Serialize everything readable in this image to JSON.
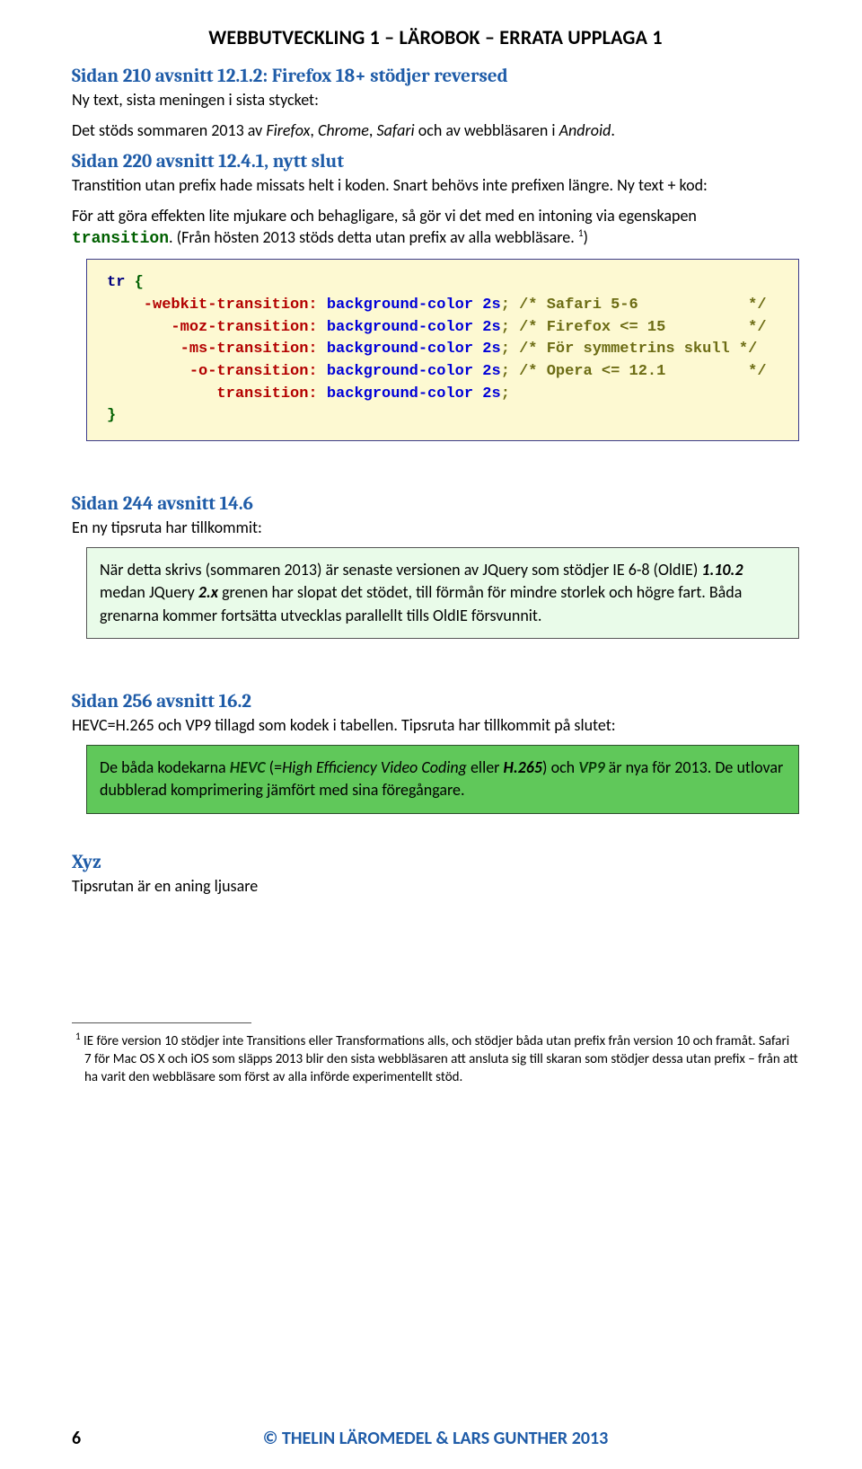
{
  "docTitle": "WEBBUTVECKLING 1 – LÄROBOK – ERRATA UPPLAGA 1",
  "sec1": {
    "heading": "Sidan 210 avsnitt 12.1.2: Firefox 18+ stödjer reversed",
    "line1": "Ny text, sista meningen i sista stycket:",
    "line2_lead": "Det stöds sommaren 2013 av ",
    "firefox": "Firefox",
    "chrome": "Chrome",
    "safari": "Safari",
    "mid": " och av webbläsaren i ",
    "android": "Android"
  },
  "sec2": {
    "heading": "Sidan 220 avsnitt 12.4.1, nytt slut",
    "line1": "Transtition utan prefix hade missats helt i koden. Snart behövs inte prefixen längre. Ny text + kod:",
    "line2a": "För att göra effekten lite mjukare och behagligare, så gör vi det med en intoning via egenskapen ",
    "transitionWord": "transition",
    "line2b": ". (Från hösten 2013 stöds detta utan prefix av alla webbläsare. ",
    "footRef": "1",
    "line2c": ")",
    "code": {
      "l0a": "tr",
      "l0b": " {",
      "l1a": "    -webkit-transition:",
      "l1b": " background-color 2s",
      "l1c": "; /* Safari 5-6            */",
      "l2a": "       -moz-transition:",
      "l2b": " background-color 2s",
      "l2c": "; /* Firefox <= 15         */",
      "l3a": "        -ms-transition:",
      "l3b": " background-color 2s",
      "l3c": "; /* För symmetrins skull */",
      "l4a": "         -o-transition:",
      "l4b": " background-color 2s",
      "l4c": "; /* Opera <= 12.1         */",
      "l5a": "            transition:",
      "l5b": " background-color 2s",
      "l5c": ";",
      "l6": "}"
    }
  },
  "sec3": {
    "heading": "Sidan 244 avsnitt 14.6",
    "line1": "En ny tipsruta har tillkommit:",
    "boxA": "När detta skrivs (sommaren 2013) är senaste versionen av JQuery som stödjer IE 6-8 (OldIE) ",
    "v1": "1.10.2",
    "boxB": " medan JQuery ",
    "v2": "2.x",
    "boxC": " grenen har slopat det stödet, till förmån för mindre storlek och högre fart. Båda grenarna kommer fortsätta utvecklas parallellt tills OldIE försvunnit."
  },
  "sec4": {
    "heading": "Sidan 256 avsnitt 16.2",
    "line1": "HEVC=H.265 och VP9 tillagd som kodek i tabellen. Tipsruta har tillkommit på slutet:",
    "boxA": "De båda kodekarna ",
    "hevc": "HEVC",
    "boxB": " (=",
    "hevcLong": "High Efficiency Video Coding",
    "boxC": " eller ",
    "h265": "H.265",
    "boxD": ") och ",
    "vp9": "VP9",
    "boxE": " är nya för 2013. De utlovar dubblerad komprimering jämfört med sina föregångare."
  },
  "sec5": {
    "heading": "Xyz",
    "line1": "Tipsrutan är en aning ljusare"
  },
  "footnote": {
    "ref": "1",
    "text": " IE före version 10 stödjer inte Transitions eller Transformations alls, och stödjer båda utan prefix från version 10 och framåt. Safari 7 för Mac OS X och iOS som släpps 2013 blir den sista webbläsaren att ansluta sig till skaran som stödjer dessa utan prefix – från att ha varit den webbläsare som först av alla införde experimentellt stöd."
  },
  "footer": {
    "pageNum": "6",
    "copyright": "© THELIN LÄROMEDEL & LARS GUNTHER 2013"
  }
}
